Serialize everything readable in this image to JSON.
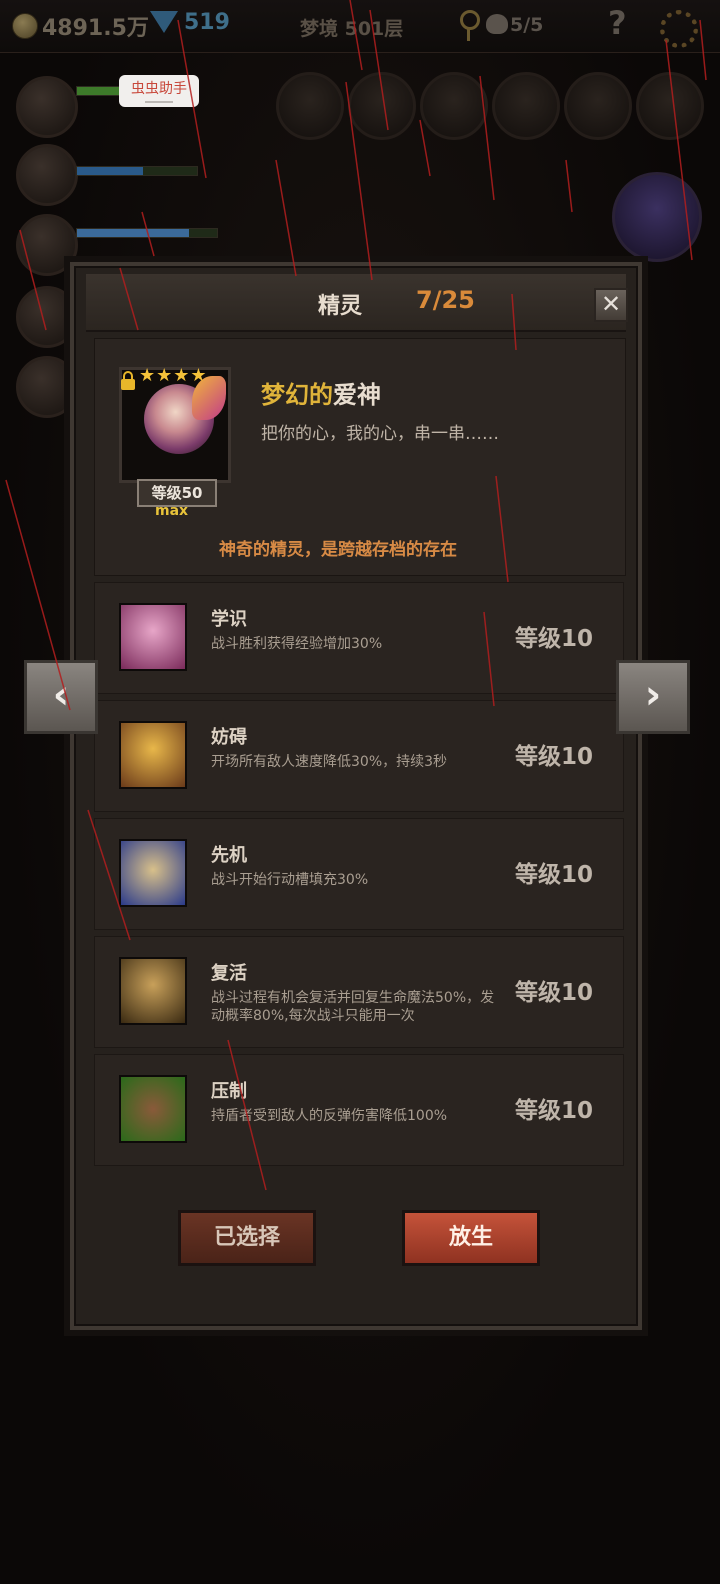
{
  "topbar": {
    "gold": "4891.5万",
    "gems": "519",
    "dream_level": "梦境 501层",
    "skull_count": "5/5",
    "help_label": "?"
  },
  "helper_badge": "虫虫助手",
  "panel": {
    "title": "精灵",
    "count": "7/25",
    "close_label": "✕",
    "sprite": {
      "stars": "★★★★",
      "name_part1": "梦幻的",
      "name_part2": "爱神",
      "description": "把你的心，我的心，串一串……",
      "level_label": "等级50",
      "max_label": "max",
      "note": "神奇的精灵，是跨越存档的存在"
    },
    "skills": [
      {
        "name": "学识",
        "desc": "战斗胜利获得经验增加30%",
        "level": "等级10"
      },
      {
        "name": "妨碍",
        "desc": "开场所有敌人速度降低30%，持续3秒",
        "level": "等级10"
      },
      {
        "name": "先机",
        "desc": "战斗开始行动槽填充30%",
        "level": "等级10"
      },
      {
        "name": "复活",
        "desc": "战斗过程有机会复活并回复生命魔法50%，发动概率80%,每次战斗只能用一次",
        "level": "等级10"
      },
      {
        "name": "压制",
        "desc": "持盾者受到敌人的反弹伤害降低100%",
        "level": "等级10"
      }
    ],
    "buttons": {
      "selected": "已选择",
      "release": "放生"
    }
  },
  "nav": {
    "prev": "‹",
    "next": "›"
  },
  "colors": {
    "accent_orange": "#d98a3a",
    "gold_text": "#e0b43a",
    "release_button": "#c5533a"
  }
}
